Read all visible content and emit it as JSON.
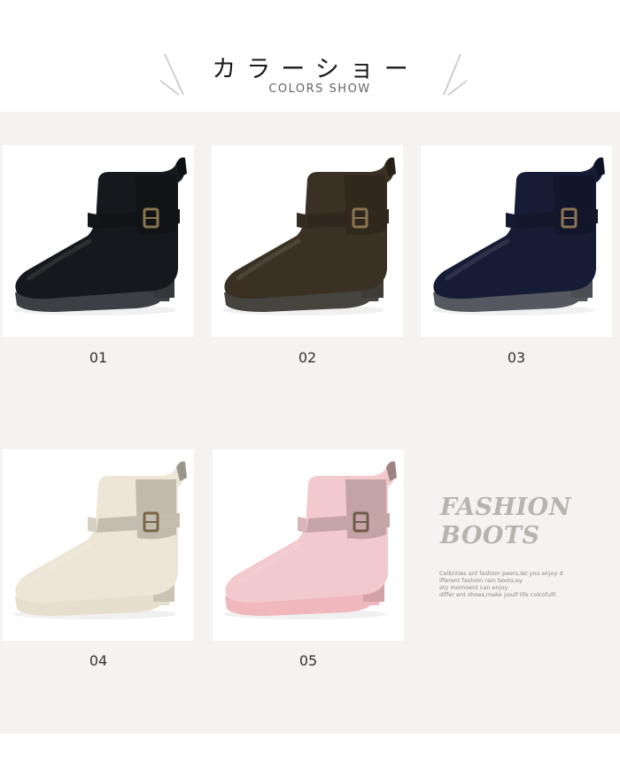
{
  "header": {
    "title_jp": "カラーショー",
    "title_en": "COLORS SHOW"
  },
  "products": [
    {
      "number": "01",
      "color": "#15181c",
      "sole": "#3c3f44",
      "buckle": "#8c7450",
      "image_icon": "chelsea-rain-boot-black"
    },
    {
      "number": "02",
      "color": "#3a3124",
      "sole": "#46443f",
      "buckle": "#8c7450",
      "image_icon": "chelsea-rain-boot-brown"
    },
    {
      "number": "03",
      "color": "#171c36",
      "sole": "#55585e",
      "buckle": "#8c7450",
      "image_icon": "chelsea-rain-boot-navy"
    },
    {
      "number": "04",
      "color": "#ede6d6",
      "sole": "#e7dfcd",
      "buckle": "#7a6548",
      "image_icon": "chelsea-rain-boot-cream"
    },
    {
      "number": "05",
      "color": "#f2c9cc",
      "sole": "#f0b8bd",
      "buckle": "#6e5b4a",
      "image_icon": "chelsea-rain-boot-pink"
    }
  ],
  "promo": {
    "title_line1": "FASHION",
    "title_line2": "BOOTS",
    "desc_lines": [
      "Celbrities anf fashion peers,let you enjoy d",
      "ifferent fashion rain boots,ey",
      "ety momoent can enjoy",
      "differ ent shoes,make youlf life colcofulll"
    ]
  },
  "colors": {
    "page_bg": "#ffffff",
    "gallery_bg": "#f4f3f1",
    "title": "#1a1a1a",
    "subtitle": "#666666",
    "promo_title": "#b7b3ae",
    "promo_text": "#8a8785",
    "decorative_lines": "#cfcfcf"
  }
}
